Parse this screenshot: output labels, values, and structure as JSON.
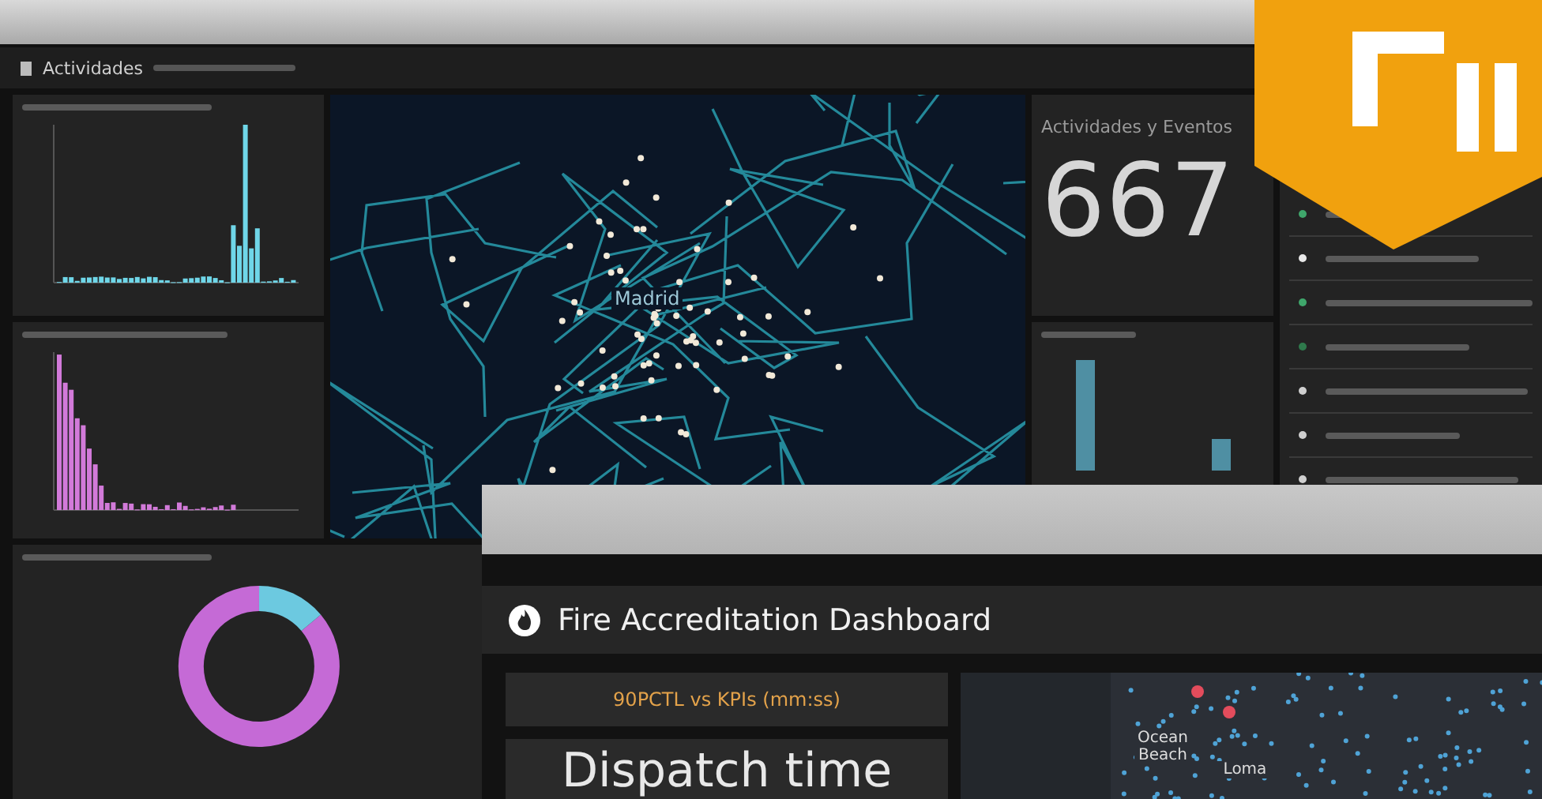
{
  "background_dashboard": {
    "header": {
      "title": "Actividades"
    },
    "map": {
      "label": "Madrid"
    },
    "kpi": {
      "title": "Actividades y Eventos",
      "value": "667"
    },
    "list": {
      "items": [
        {
          "color": "#3fa66b"
        },
        {
          "color": "#e8e8e8"
        },
        {
          "color": "#3fa66b"
        },
        {
          "color": "#2f7a4c"
        },
        {
          "color": "#cfcfcf"
        },
        {
          "color": "#cfcfcf"
        },
        {
          "color": "#cfcfcf"
        }
      ]
    }
  },
  "front_window": {
    "title": "Fire Accreditation Dashboard",
    "kpi_heading": "90PCTL vs KPIs (mm:ss)",
    "indicator_title": "Dispatch time",
    "map_labels": [
      "Ocean Beach",
      "Loma"
    ]
  }
}
